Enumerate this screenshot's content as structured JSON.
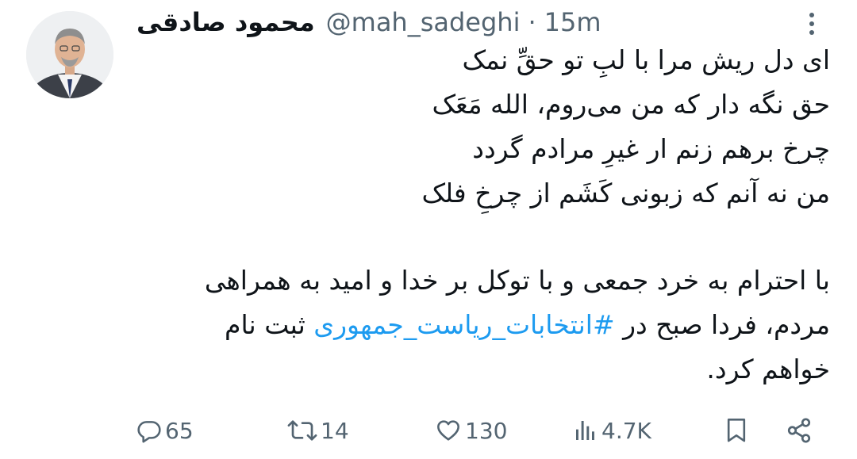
{
  "tweet": {
    "author": {
      "display_name": "محمود صادقی",
      "handle": "@mah_sadeghi",
      "separator": "·",
      "time": "15m"
    },
    "poem_lines": [
      "ای دل ریش مرا با لبِ تو حقِّ نمک",
      "حق نگه دار که من می‌روم، الله مَعَک",
      "چرخ برهم زنم ار غیرِ مرادم گردد",
      "من نه آنم که زبونی کَشَم از چرخِ فلک"
    ],
    "message": {
      "line1": "با احترام به خرد جمعی و با توکل بر خدا و امید به همراهی",
      "line2_before": "مردم، فردا صبح در ",
      "hashtag": "#انتخابات_ریاست_جمهوری",
      "line2_after": " ثبت نام",
      "line3": "خواهم کرد."
    },
    "actions": {
      "replies": "65",
      "retweets": "14",
      "likes": "130",
      "views": "4.7K"
    },
    "icons": {
      "reply": "reply-icon",
      "retweet": "retweet-icon",
      "like": "heart-icon",
      "views": "views-icon",
      "bookmark": "bookmark-icon",
      "share": "share-icon",
      "more": "more-icon"
    },
    "colors": {
      "text": "#0f1419",
      "muted": "#536471",
      "link": "#1d9bf0"
    }
  }
}
